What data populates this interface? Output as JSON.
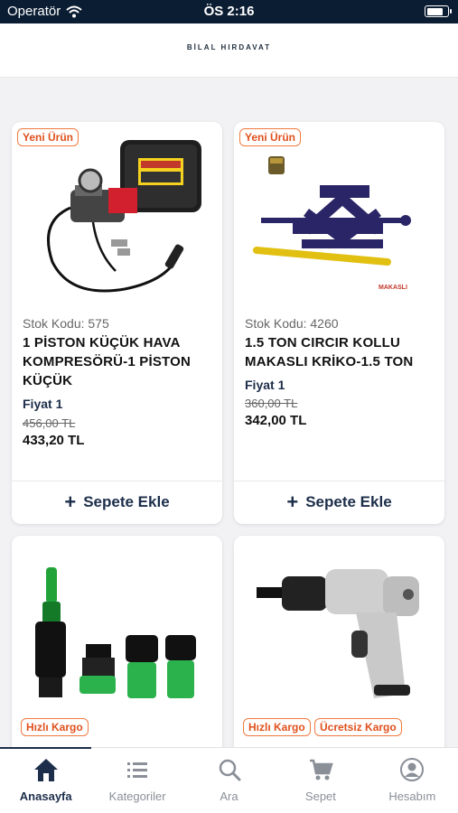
{
  "status_bar": {
    "carrier": "Operatör",
    "time": "ÖS 2:16",
    "battery_level": 0.85
  },
  "header": {
    "logo_text": "BİLAL HIRDAVAT"
  },
  "products": [
    {
      "badges": [
        "Yeni Ürün"
      ],
      "stock_code": "Stok Kodu: 575",
      "name": "1 PİSTON KÜÇÜK HAVA KOMPRESÖRÜ-1 PİSTON KÜÇÜK",
      "price_label": "Fiyat 1",
      "old_price": "456,00 TL",
      "price": "433,20 TL",
      "add_button": "Sepete Ekle",
      "image_icon": "air-compressor-icon"
    },
    {
      "badges": [
        "Yeni Ürün"
      ],
      "stock_code": "Stok Kodu: 4260",
      "name": "1.5 TON CIRCIR KOLLU MAKASLI KRİKO-1.5 TON",
      "price_label": "Fiyat 1",
      "old_price": "360,00 TL",
      "price": "342,00 TL",
      "add_button": "Sepete Ekle",
      "image_icon": "scissor-jack-icon",
      "image_caption": "MAKASLI"
    },
    {
      "badges": [
        "Hızlı Kargo"
      ],
      "image_icon": "garden-hose-fittings-icon"
    },
    {
      "badges": [
        "Hızlı Kargo",
        "Ücretsiz Kargo"
      ],
      "image_icon": "impact-wrench-icon"
    }
  ],
  "tabs": [
    {
      "label": "Anasayfa",
      "icon": "home-icon",
      "active": true
    },
    {
      "label": "Kategoriler",
      "icon": "list-icon",
      "active": false
    },
    {
      "label": "Ara",
      "icon": "search-icon",
      "active": false
    },
    {
      "label": "Sepet",
      "icon": "cart-icon",
      "active": false
    },
    {
      "label": "Hesabım",
      "icon": "account-icon",
      "active": false
    }
  ],
  "colors": {
    "primary": "#1c2e4a",
    "badge": "#e0501c",
    "status_bar": "#0b1d33",
    "background": "#f2f2f4"
  }
}
